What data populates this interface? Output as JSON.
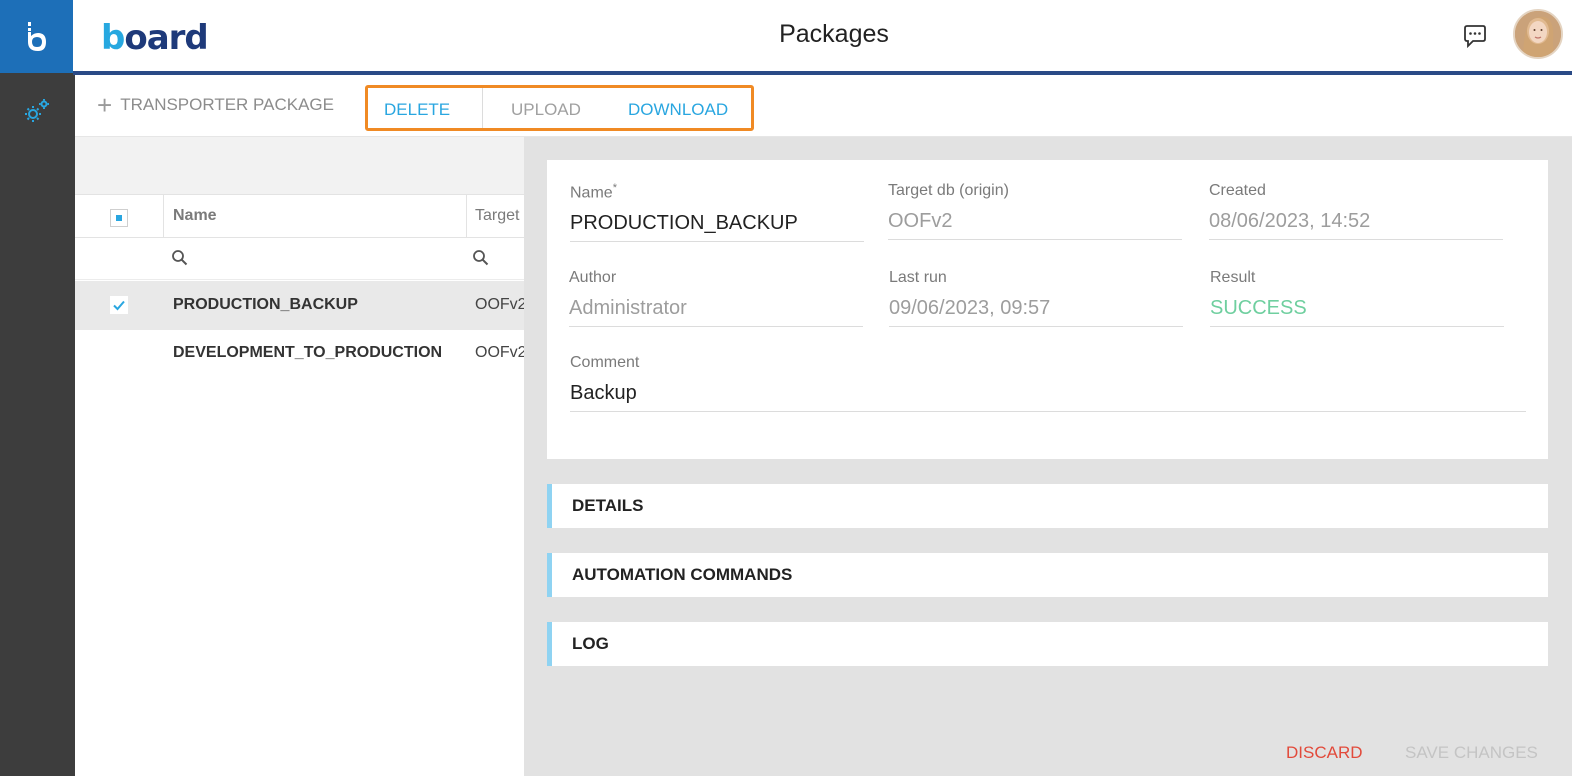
{
  "app": {
    "title": "Packages",
    "brand_prefix": "b",
    "brand_rest": "oard"
  },
  "header": {
    "chat_icon": "chat-icon",
    "avatar": "user-avatar"
  },
  "rail": {
    "logo_letter": "b",
    "settings_icon": "gear-icon"
  },
  "toolbar": {
    "add_label": "TRANSPORTER PACKAGE",
    "delete_label": "DELETE",
    "upload_label": "UPLOAD",
    "download_label": "DOWNLOAD"
  },
  "list": {
    "columns": [
      {
        "label": "Name"
      },
      {
        "label": "Target"
      }
    ],
    "rows": [
      {
        "name": "PRODUCTION_BACKUP",
        "target": "OOFv2",
        "selected": true
      },
      {
        "name": "DEVELOPMENT_TO_PRODUCTION",
        "target": "OOFv2",
        "selected": false
      }
    ]
  },
  "detail": {
    "name_label": "Name",
    "name_required": "*",
    "name_value": "PRODUCTION_BACKUP",
    "target_label": "Target db (origin)",
    "target_value": "OOFv2",
    "created_label": "Created",
    "created_value": "08/06/2023, 14:52",
    "author_label": "Author",
    "author_value": "Administrator",
    "lastrun_label": "Last run",
    "lastrun_value": "09/06/2023, 09:57",
    "result_label": "Result",
    "result_value": "SUCCESS",
    "comment_label": "Comment",
    "comment_value": "Backup"
  },
  "sections": [
    {
      "label": "DETAILS"
    },
    {
      "label": "AUTOMATION COMMANDS"
    },
    {
      "label": "LOG"
    }
  ],
  "footer": {
    "discard_label": "DISCARD",
    "save_label": "SAVE CHANGES"
  },
  "colors": {
    "accent": "#29a6e0",
    "highlight_box": "#f08a24",
    "success": "#6fcf9f",
    "danger": "#e24a3b",
    "disabled": "#bdbdbd",
    "header_bar": "#2a4a86"
  }
}
